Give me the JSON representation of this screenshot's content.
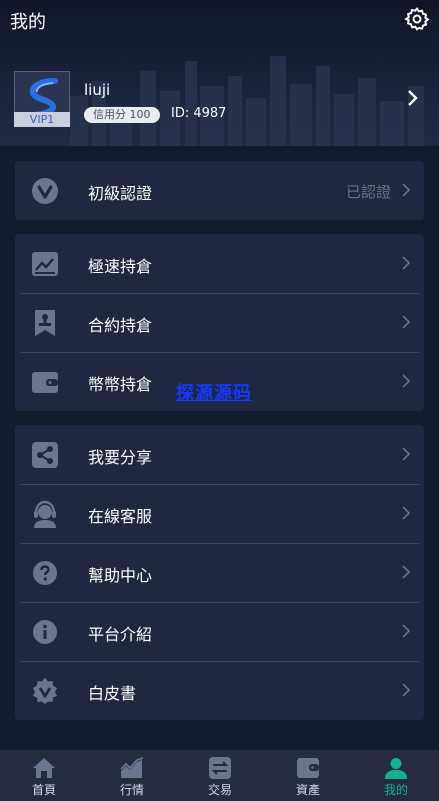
{
  "header": {
    "title": "我的",
    "username": "liuji",
    "credit_badge": "信用分 100",
    "user_id": "ID: 4987",
    "vip_label": "VIP1"
  },
  "verification": {
    "label": "初級認證",
    "status": "已認證"
  },
  "positions": [
    {
      "label": "極速持倉",
      "icon": "trend-chart-icon"
    },
    {
      "label": "合約持倉",
      "icon": "contract-icon"
    },
    {
      "label": "幣幣持倉",
      "icon": "wallet-icon"
    }
  ],
  "watermark": "探源源码",
  "more": [
    {
      "label": "我要分享",
      "icon": "share-icon"
    },
    {
      "label": "在線客服",
      "icon": "customer-service-icon"
    },
    {
      "label": "幫助中心",
      "icon": "help-icon"
    },
    {
      "label": "平台介紹",
      "icon": "info-icon"
    },
    {
      "label": "白皮書",
      "icon": "whitepaper-badge-icon"
    }
  ],
  "tabbar": [
    {
      "label": "首頁",
      "icon": "home-icon",
      "active": false
    },
    {
      "label": "行情",
      "icon": "market-chart-icon",
      "active": false
    },
    {
      "label": "交易",
      "icon": "exchange-icon",
      "active": false
    },
    {
      "label": "資產",
      "icon": "wallet-icon",
      "active": false
    },
    {
      "label": "我的",
      "icon": "user-icon",
      "active": true
    }
  ],
  "colors": {
    "background": "#131b2e",
    "card": "#1f2840",
    "accent_active": "#10b48a",
    "icon": "#6a7590",
    "status_text": "#6a7289"
  }
}
